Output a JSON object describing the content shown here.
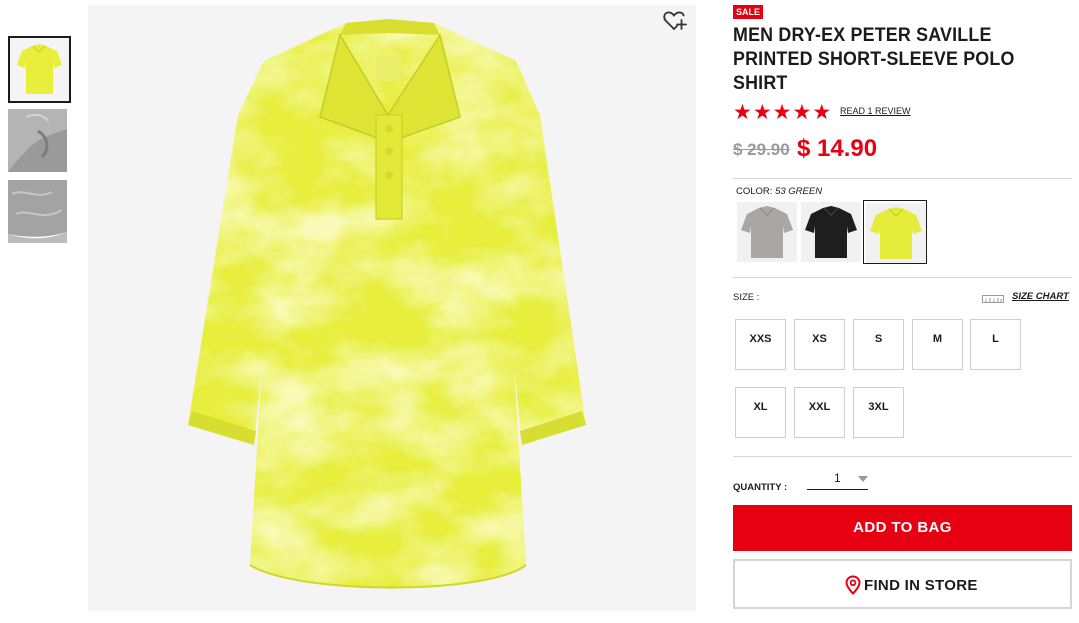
{
  "product": {
    "badge": "SALE",
    "title": "MEN DRY-EX PETER SAVILLE PRINTED SHORT-SLEEVE POLO SHIRT",
    "rating_stars": 5,
    "review_link": "READ 1 REVIEW",
    "price_original": "$ 29.90",
    "price_sale": "$ 14.90"
  },
  "color": {
    "label": "COLOR:",
    "selected": "53 GREEN",
    "swatches": [
      {
        "name": "gray",
        "hex": "#a9a6a6"
      },
      {
        "name": "black",
        "hex": "#1e1e1e"
      },
      {
        "name": "green",
        "hex": "#e5ec3a"
      }
    ]
  },
  "size": {
    "label": "SIZE :",
    "chart_link": "SIZE CHART",
    "options": [
      "XXS",
      "XS",
      "S",
      "M",
      "L",
      "XL",
      "XXL",
      "3XL"
    ]
  },
  "quantity": {
    "label": "QUANTITY :",
    "value": "1"
  },
  "actions": {
    "add_to_bag": "ADD TO BAG",
    "find_in_store": "FIND IN STORE"
  },
  "colors": {
    "brand_red": "#e60012",
    "product_yellow": "#e7ee3c"
  },
  "icons": {
    "wishlist": "heart-plus-icon",
    "store": "map-pin-icon",
    "size_chart": "ruler-icon",
    "quantity": "caret-down-icon"
  }
}
